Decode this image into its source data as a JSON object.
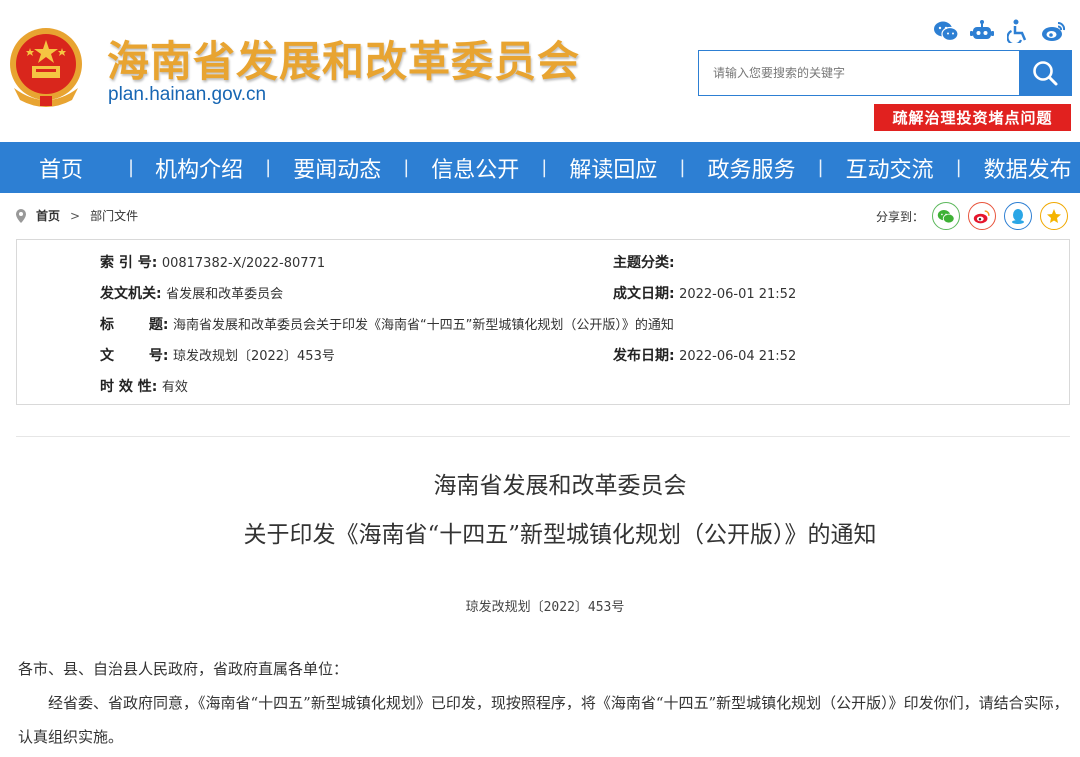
{
  "site": {
    "title": "海南省发展和改革委员会",
    "domain": "plan.hainan.gov.cn"
  },
  "top_icons": [
    "wechat-icon",
    "robot-icon",
    "accessibility-icon",
    "weibo-icon"
  ],
  "search": {
    "placeholder": "请输入您要搜索的关键字"
  },
  "hot_topic": "疏解治理投资堵点问题",
  "nav": {
    "separator": "|",
    "items": [
      "首页",
      "机构介绍",
      "要闻动态",
      "信息公开",
      "解读回应",
      "政务服务",
      "互动交流",
      "数据发布"
    ]
  },
  "breadcrumb": {
    "home": "首页",
    "arrow": ">",
    "current": "部门文件"
  },
  "share": {
    "label": "分享到：",
    "icons": [
      "wechat-icon",
      "weibo-icon",
      "qq-icon",
      "qzone-icon"
    ]
  },
  "meta": {
    "index_key": "索 引 号:",
    "index_val": "00817382-X/2022-80771",
    "topic_key": "主题分类:",
    "topic_val": "",
    "issuer_key": "发文机关:",
    "issuer_val": "省发展和改革委员会",
    "created_key": "成文日期:",
    "created_val": "2022-06-01 21:52",
    "title_key": "标 题:",
    "title_val": "海南省发展和改革委员会关于印发《海南省“十四五”新型城镇化规划（公开版）》的通知",
    "docno_key": "文 号:",
    "docno_val": "琼发改规划〔2022〕453号",
    "published_key": "发布日期:",
    "published_val": "2022-06-04 21:52",
    "validity_key": "时 效 性:",
    "validity_val": "有效"
  },
  "article": {
    "title_line1": "海南省发展和改革委员会",
    "title_line2": "关于印发《海南省“十四五”新型城镇化规划（公开版）》的通知",
    "doc_number": "琼发改规划〔2022〕453号",
    "salutation": "各市、县、自治县人民政府，省政府直属各单位：",
    "body": "经省委、省政府同意，《海南省“十四五”新型城镇化规划》已印发，现按照程序，将《海南省“十四五”新型城镇化规划（公开版）》印发你们，请结合实际，认真组织实施。"
  },
  "colors": {
    "brand_blue": "#2d7fd3",
    "title_gold": "#e8a431",
    "alert_red": "#e1211f"
  }
}
